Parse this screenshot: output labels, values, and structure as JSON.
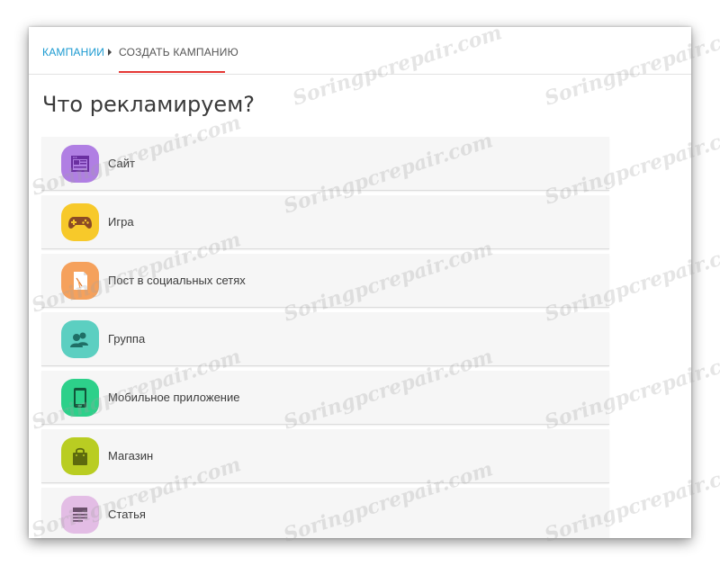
{
  "breadcrumb": {
    "root_label": "КАМПАНИИ",
    "current_label": "СОЗДАТЬ КАМПАНИЮ"
  },
  "page": {
    "title": "Что рекламируем?"
  },
  "items": [
    {
      "label": "Сайт",
      "icon": "website-icon",
      "color": "#b07fe3"
    },
    {
      "label": "Игра",
      "icon": "gamepad-icon",
      "color": "#f7c92a"
    },
    {
      "label": "Пост в социальных сетях",
      "icon": "post-icon",
      "color": "#f5a15c"
    },
    {
      "label": "Группа",
      "icon": "group-icon",
      "color": "#5ccfc1"
    },
    {
      "label": "Мобильное приложение",
      "icon": "mobile-app-icon",
      "color": "#2dd08a"
    },
    {
      "label": "Магазин",
      "icon": "shopping-bag-icon",
      "color": "#b9cd22"
    },
    {
      "label": "Статья",
      "icon": "article-icon",
      "color": "#e3bde5"
    }
  ],
  "watermark": "Soringpcrepair.com"
}
